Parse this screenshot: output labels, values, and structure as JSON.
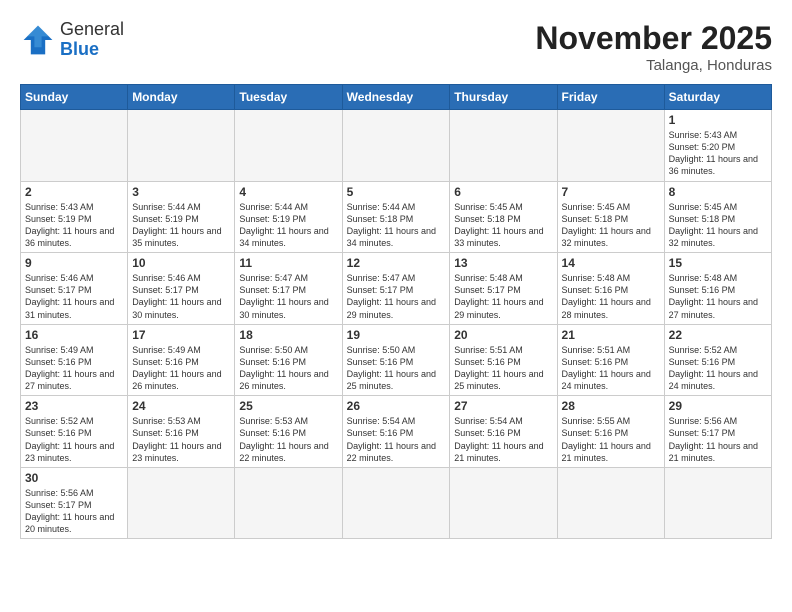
{
  "header": {
    "logo_general": "General",
    "logo_blue": "Blue",
    "month_title": "November 2025",
    "location": "Talanga, Honduras"
  },
  "days_of_week": [
    "Sunday",
    "Monday",
    "Tuesday",
    "Wednesday",
    "Thursday",
    "Friday",
    "Saturday"
  ],
  "weeks": [
    [
      {
        "day": "",
        "empty": true
      },
      {
        "day": "",
        "empty": true
      },
      {
        "day": "",
        "empty": true
      },
      {
        "day": "",
        "empty": true
      },
      {
        "day": "",
        "empty": true
      },
      {
        "day": "",
        "empty": true
      },
      {
        "day": "1",
        "sunrise": "5:43 AM",
        "sunset": "5:20 PM",
        "daylight": "11 hours and 36 minutes."
      }
    ],
    [
      {
        "day": "2",
        "sunrise": "5:43 AM",
        "sunset": "5:19 PM",
        "daylight": "11 hours and 36 minutes."
      },
      {
        "day": "3",
        "sunrise": "5:44 AM",
        "sunset": "5:19 PM",
        "daylight": "11 hours and 35 minutes."
      },
      {
        "day": "4",
        "sunrise": "5:44 AM",
        "sunset": "5:19 PM",
        "daylight": "11 hours and 34 minutes."
      },
      {
        "day": "5",
        "sunrise": "5:44 AM",
        "sunset": "5:18 PM",
        "daylight": "11 hours and 34 minutes."
      },
      {
        "day": "6",
        "sunrise": "5:45 AM",
        "sunset": "5:18 PM",
        "daylight": "11 hours and 33 minutes."
      },
      {
        "day": "7",
        "sunrise": "5:45 AM",
        "sunset": "5:18 PM",
        "daylight": "11 hours and 32 minutes."
      },
      {
        "day": "8",
        "sunrise": "5:45 AM",
        "sunset": "5:18 PM",
        "daylight": "11 hours and 32 minutes."
      }
    ],
    [
      {
        "day": "9",
        "sunrise": "5:46 AM",
        "sunset": "5:17 PM",
        "daylight": "11 hours and 31 minutes."
      },
      {
        "day": "10",
        "sunrise": "5:46 AM",
        "sunset": "5:17 PM",
        "daylight": "11 hours and 30 minutes."
      },
      {
        "day": "11",
        "sunrise": "5:47 AM",
        "sunset": "5:17 PM",
        "daylight": "11 hours and 30 minutes."
      },
      {
        "day": "12",
        "sunrise": "5:47 AM",
        "sunset": "5:17 PM",
        "daylight": "11 hours and 29 minutes."
      },
      {
        "day": "13",
        "sunrise": "5:48 AM",
        "sunset": "5:17 PM",
        "daylight": "11 hours and 29 minutes."
      },
      {
        "day": "14",
        "sunrise": "5:48 AM",
        "sunset": "5:16 PM",
        "daylight": "11 hours and 28 minutes."
      },
      {
        "day": "15",
        "sunrise": "5:48 AM",
        "sunset": "5:16 PM",
        "daylight": "11 hours and 27 minutes."
      }
    ],
    [
      {
        "day": "16",
        "sunrise": "5:49 AM",
        "sunset": "5:16 PM",
        "daylight": "11 hours and 27 minutes."
      },
      {
        "day": "17",
        "sunrise": "5:49 AM",
        "sunset": "5:16 PM",
        "daylight": "11 hours and 26 minutes."
      },
      {
        "day": "18",
        "sunrise": "5:50 AM",
        "sunset": "5:16 PM",
        "daylight": "11 hours and 26 minutes."
      },
      {
        "day": "19",
        "sunrise": "5:50 AM",
        "sunset": "5:16 PM",
        "daylight": "11 hours and 25 minutes."
      },
      {
        "day": "20",
        "sunrise": "5:51 AM",
        "sunset": "5:16 PM",
        "daylight": "11 hours and 25 minutes."
      },
      {
        "day": "21",
        "sunrise": "5:51 AM",
        "sunset": "5:16 PM",
        "daylight": "11 hours and 24 minutes."
      },
      {
        "day": "22",
        "sunrise": "5:52 AM",
        "sunset": "5:16 PM",
        "daylight": "11 hours and 24 minutes."
      }
    ],
    [
      {
        "day": "23",
        "sunrise": "5:52 AM",
        "sunset": "5:16 PM",
        "daylight": "11 hours and 23 minutes."
      },
      {
        "day": "24",
        "sunrise": "5:53 AM",
        "sunset": "5:16 PM",
        "daylight": "11 hours and 23 minutes."
      },
      {
        "day": "25",
        "sunrise": "5:53 AM",
        "sunset": "5:16 PM",
        "daylight": "11 hours and 22 minutes."
      },
      {
        "day": "26",
        "sunrise": "5:54 AM",
        "sunset": "5:16 PM",
        "daylight": "11 hours and 22 minutes."
      },
      {
        "day": "27",
        "sunrise": "5:54 AM",
        "sunset": "5:16 PM",
        "daylight": "11 hours and 21 minutes."
      },
      {
        "day": "28",
        "sunrise": "5:55 AM",
        "sunset": "5:16 PM",
        "daylight": "11 hours and 21 minutes."
      },
      {
        "day": "29",
        "sunrise": "5:56 AM",
        "sunset": "5:17 PM",
        "daylight": "11 hours and 21 minutes."
      }
    ],
    [
      {
        "day": "30",
        "sunrise": "5:56 AM",
        "sunset": "5:17 PM",
        "daylight": "11 hours and 20 minutes."
      },
      {
        "day": "",
        "empty": true
      },
      {
        "day": "",
        "empty": true
      },
      {
        "day": "",
        "empty": true
      },
      {
        "day": "",
        "empty": true
      },
      {
        "day": "",
        "empty": true
      },
      {
        "day": "",
        "empty": true
      }
    ]
  ],
  "labels": {
    "sunrise": "Sunrise:",
    "sunset": "Sunset:",
    "daylight": "Daylight:"
  }
}
